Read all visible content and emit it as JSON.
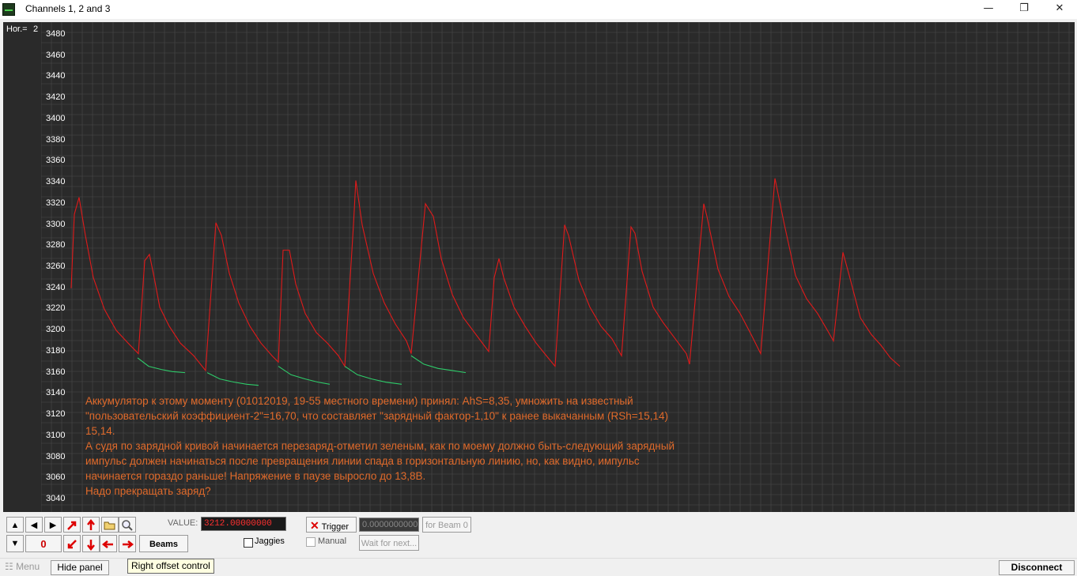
{
  "window": {
    "title": "Channels 1, 2 and 3",
    "minimize": "—",
    "maximize": "❐",
    "close": "✕"
  },
  "scope": {
    "hor_label": "Hor.=",
    "hor_value": "2",
    "annotation": "Аккумулятор к этому моменту (01012019, 19-55 местного времени) принял: AhS=8,35, умножить на известный\n\"пользовательский коэффициент-2\"=16,70, что составляет \"зарядный фактор-1,10\" к ранее выкачанным (RSh=15,14)\n15,14.\nА судя по зарядной кривой начинается перезаряд-отметил зеленым, как по моему должно быть-следующий зарядный\nимпульс должен начинаться после превращения линии спада в горизонтальную линию, но, как видно, импульс\nначинается гораздо раньше! Напряжение в паузе выросло до 13,8В.\nНадо прекращать заряд?"
  },
  "chart_data": {
    "type": "line",
    "y_ticks": [
      3040,
      3060,
      3080,
      3100,
      3120,
      3140,
      3160,
      3180,
      3200,
      3220,
      3240,
      3260,
      3280,
      3300,
      3320,
      3340,
      3360,
      3380,
      3400,
      3420,
      3440,
      3460,
      3480
    ],
    "ylim": [
      3028,
      3492
    ],
    "xlim": [
      0,
      1306
    ],
    "grid": true,
    "series": [
      {
        "color": "#e01a1a",
        "points": [
          [
            38,
            3240
          ],
          [
            42,
            3310
          ],
          [
            48,
            3326
          ],
          [
            56,
            3290
          ],
          [
            66,
            3250
          ],
          [
            80,
            3220
          ],
          [
            95,
            3200
          ],
          [
            110,
            3188
          ],
          [
            123,
            3178
          ],
          [
            131,
            3266
          ],
          [
            137,
            3272
          ],
          [
            143,
            3250
          ],
          [
            150,
            3222
          ],
          [
            162,
            3204
          ],
          [
            176,
            3188
          ],
          [
            193,
            3176
          ],
          [
            208,
            3162
          ],
          [
            221,
            3302
          ],
          [
            228,
            3290
          ],
          [
            238,
            3254
          ],
          [
            250,
            3226
          ],
          [
            264,
            3204
          ],
          [
            278,
            3188
          ],
          [
            292,
            3176
          ],
          [
            300,
            3170
          ],
          [
            306,
            3276
          ],
          [
            314,
            3276
          ],
          [
            322,
            3244
          ],
          [
            334,
            3216
          ],
          [
            348,
            3198
          ],
          [
            362,
            3188
          ],
          [
            376,
            3176
          ],
          [
            384,
            3166
          ],
          [
            395,
            3300
          ],
          [
            398,
            3342
          ],
          [
            406,
            3300
          ],
          [
            420,
            3254
          ],
          [
            434,
            3226
          ],
          [
            448,
            3206
          ],
          [
            462,
            3190
          ],
          [
            468,
            3178
          ],
          [
            486,
            3320
          ],
          [
            496,
            3308
          ],
          [
            506,
            3268
          ],
          [
            520,
            3234
          ],
          [
            534,
            3212
          ],
          [
            548,
            3198
          ],
          [
            560,
            3186
          ],
          [
            566,
            3180
          ],
          [
            573,
            3250
          ],
          [
            579,
            3268
          ],
          [
            585,
            3250
          ],
          [
            598,
            3222
          ],
          [
            612,
            3204
          ],
          [
            626,
            3188
          ],
          [
            639,
            3176
          ],
          [
            650,
            3166
          ],
          [
            662,
            3300
          ],
          [
            667,
            3290
          ],
          [
            680,
            3248
          ],
          [
            694,
            3222
          ],
          [
            708,
            3204
          ],
          [
            722,
            3192
          ],
          [
            734,
            3176
          ],
          [
            746,
            3298
          ],
          [
            751,
            3292
          ],
          [
            760,
            3256
          ],
          [
            774,
            3222
          ],
          [
            786,
            3208
          ],
          [
            800,
            3194
          ],
          [
            816,
            3178
          ],
          [
            820,
            3168
          ],
          [
            838,
            3320
          ],
          [
            842,
            3308
          ],
          [
            856,
            3258
          ],
          [
            870,
            3232
          ],
          [
            884,
            3216
          ],
          [
            898,
            3196
          ],
          [
            910,
            3178
          ],
          [
            928,
            3344
          ],
          [
            940,
            3300
          ],
          [
            954,
            3252
          ],
          [
            968,
            3230
          ],
          [
            982,
            3216
          ],
          [
            996,
            3198
          ],
          [
            1002,
            3190
          ],
          [
            1014,
            3274
          ],
          [
            1022,
            3252
          ],
          [
            1036,
            3212
          ],
          [
            1050,
            3196
          ],
          [
            1062,
            3186
          ],
          [
            1074,
            3174
          ],
          [
            1086,
            3166
          ]
        ]
      },
      {
        "color": "#2ecc6a",
        "points": [
          [
            122,
            3174
          ],
          [
            136,
            3166
          ],
          [
            152,
            3163
          ],
          [
            166,
            3161
          ],
          [
            182,
            3160
          ]
        ]
      },
      {
        "color": "#2ecc6a",
        "points": [
          [
            210,
            3160
          ],
          [
            226,
            3154
          ],
          [
            244,
            3151
          ],
          [
            260,
            3149
          ],
          [
            275,
            3148
          ]
        ]
      },
      {
        "color": "#2ecc6a",
        "points": [
          [
            300,
            3166
          ],
          [
            316,
            3158
          ],
          [
            334,
            3154
          ],
          [
            350,
            3151
          ],
          [
            365,
            3149
          ]
        ]
      },
      {
        "color": "#2ecc6a",
        "points": [
          [
            384,
            3166
          ],
          [
            400,
            3158
          ],
          [
            418,
            3154
          ],
          [
            436,
            3151
          ],
          [
            456,
            3149
          ]
        ]
      },
      {
        "color": "#2ecc6a",
        "points": [
          [
            468,
            3176
          ],
          [
            484,
            3168
          ],
          [
            502,
            3164
          ],
          [
            520,
            3162
          ],
          [
            537,
            3160
          ]
        ]
      }
    ]
  },
  "controls": {
    "up_arrow": "▲",
    "down_arrow": "▼",
    "left_arrow": "◀",
    "right_arrow": "▶",
    "zero_value": "0",
    "value_label": "VALUE:",
    "value": "3212.00000000",
    "trigger_label": "Trigger",
    "trigger_value": "0.0000000000",
    "for_beam": "for Beam 0",
    "beams_label": "Beams",
    "jaggies_label": "Jaggies",
    "manual_label": "Manual",
    "wait_label": "Wait for next..."
  },
  "taskbar": {
    "menu": "Menu",
    "hide_panel": "Hide panel",
    "tooltip": "Right offset control",
    "disconnect": "Disconnect"
  }
}
